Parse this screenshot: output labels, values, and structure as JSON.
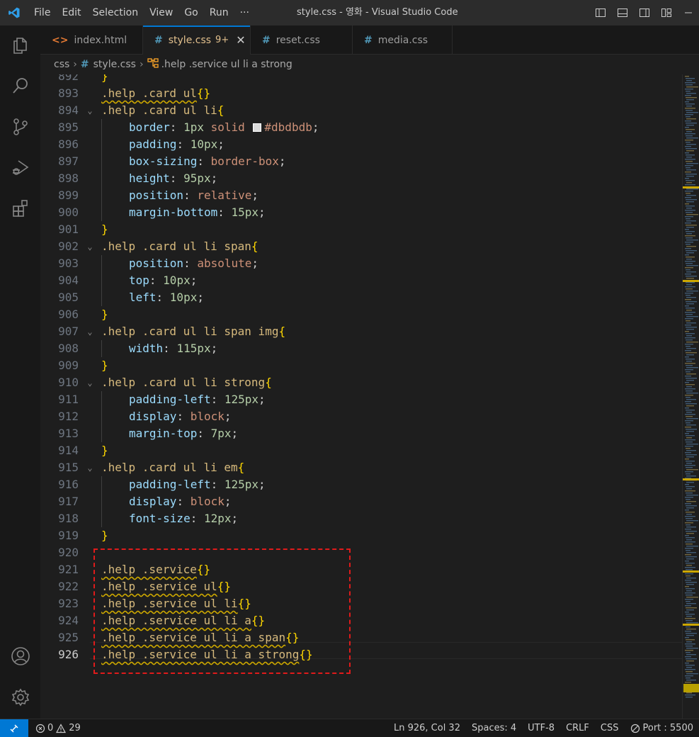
{
  "window": {
    "title": "style.css - 영화 - Visual Studio Code",
    "menu": [
      "File",
      "Edit",
      "Selection",
      "View",
      "Go",
      "Run",
      "···"
    ]
  },
  "tabs": [
    {
      "label": "index.html",
      "icon": "html-file-icon",
      "icon_glyph": "<>",
      "active": false
    },
    {
      "label": "style.css",
      "icon": "css-file-icon",
      "icon_glyph": "#",
      "active": true,
      "badge": "9+"
    },
    {
      "label": "reset.css",
      "icon": "css-file-icon",
      "icon_glyph": "#",
      "active": false
    },
    {
      "label": "media.css",
      "icon": "css-file-icon",
      "icon_glyph": "#",
      "active": false
    }
  ],
  "breadcrumb": {
    "folder": "css",
    "file": "style.css",
    "symbol": ".help .service ul li a strong"
  },
  "editor": {
    "current_line": 926,
    "lines": [
      {
        "n": "892",
        "tokens": [
          {
            "t": "}",
            "c": "brace"
          }
        ]
      },
      {
        "n": "893",
        "tokens": [
          {
            "t": ".help .card ul",
            "c": "sel squig"
          },
          {
            "t": "{}",
            "c": "brace"
          }
        ]
      },
      {
        "n": "894",
        "fold": true,
        "tokens": [
          {
            "t": ".help .card ul li",
            "c": "sel"
          },
          {
            "t": "{",
            "c": "brace"
          }
        ]
      },
      {
        "n": "895",
        "indent": 1,
        "tokens": [
          {
            "t": "border",
            "c": "prop"
          },
          {
            "t": ": ",
            "c": "punc"
          },
          {
            "t": "1px",
            "c": "num"
          },
          {
            "t": " solid ",
            "c": "val"
          },
          {
            "swatch": "#dbdbdb"
          },
          {
            "t": "#dbdbdb",
            "c": "val"
          },
          {
            "t": ";",
            "c": "punc"
          }
        ]
      },
      {
        "n": "896",
        "indent": 1,
        "tokens": [
          {
            "t": "padding",
            "c": "prop"
          },
          {
            "t": ": ",
            "c": "punc"
          },
          {
            "t": "10px",
            "c": "num"
          },
          {
            "t": ";",
            "c": "punc"
          }
        ]
      },
      {
        "n": "897",
        "indent": 1,
        "tokens": [
          {
            "t": "box-sizing",
            "c": "prop"
          },
          {
            "t": ": ",
            "c": "punc"
          },
          {
            "t": "border-box",
            "c": "val"
          },
          {
            "t": ";",
            "c": "punc"
          }
        ]
      },
      {
        "n": "898",
        "indent": 1,
        "tokens": [
          {
            "t": "height",
            "c": "prop"
          },
          {
            "t": ": ",
            "c": "punc"
          },
          {
            "t": "95px",
            "c": "num"
          },
          {
            "t": ";",
            "c": "punc"
          }
        ]
      },
      {
        "n": "899",
        "indent": 1,
        "tokens": [
          {
            "t": "position",
            "c": "prop"
          },
          {
            "t": ": ",
            "c": "punc"
          },
          {
            "t": "relative",
            "c": "val"
          },
          {
            "t": ";",
            "c": "punc"
          }
        ]
      },
      {
        "n": "900",
        "indent": 1,
        "tokens": [
          {
            "t": "margin-bottom",
            "c": "prop"
          },
          {
            "t": ": ",
            "c": "punc"
          },
          {
            "t": "15px",
            "c": "num"
          },
          {
            "t": ";",
            "c": "punc"
          }
        ]
      },
      {
        "n": "901",
        "tokens": [
          {
            "t": "}",
            "c": "brace"
          }
        ]
      },
      {
        "n": "902",
        "fold": true,
        "tokens": [
          {
            "t": ".help .card ul li span",
            "c": "sel"
          },
          {
            "t": "{",
            "c": "brace"
          }
        ]
      },
      {
        "n": "903",
        "indent": 1,
        "tokens": [
          {
            "t": "position",
            "c": "prop"
          },
          {
            "t": ": ",
            "c": "punc"
          },
          {
            "t": "absolute",
            "c": "val"
          },
          {
            "t": ";",
            "c": "punc"
          }
        ]
      },
      {
        "n": "904",
        "indent": 1,
        "tokens": [
          {
            "t": "top",
            "c": "prop"
          },
          {
            "t": ": ",
            "c": "punc"
          },
          {
            "t": "10px",
            "c": "num"
          },
          {
            "t": ";",
            "c": "punc"
          }
        ]
      },
      {
        "n": "905",
        "indent": 1,
        "tokens": [
          {
            "t": "left",
            "c": "prop"
          },
          {
            "t": ": ",
            "c": "punc"
          },
          {
            "t": "10px",
            "c": "num"
          },
          {
            "t": ";",
            "c": "punc"
          }
        ]
      },
      {
        "n": "906",
        "tokens": [
          {
            "t": "}",
            "c": "brace"
          }
        ]
      },
      {
        "n": "907",
        "fold": true,
        "tokens": [
          {
            "t": ".help .card ul li span img",
            "c": "sel"
          },
          {
            "t": "{",
            "c": "brace"
          }
        ]
      },
      {
        "n": "908",
        "indent": 1,
        "tokens": [
          {
            "t": "width",
            "c": "prop"
          },
          {
            "t": ": ",
            "c": "punc"
          },
          {
            "t": "115px",
            "c": "num"
          },
          {
            "t": ";",
            "c": "punc"
          }
        ]
      },
      {
        "n": "909",
        "tokens": [
          {
            "t": "}",
            "c": "brace"
          }
        ]
      },
      {
        "n": "910",
        "fold": true,
        "tokens": [
          {
            "t": ".help .card ul li strong",
            "c": "sel"
          },
          {
            "t": "{",
            "c": "brace"
          }
        ]
      },
      {
        "n": "911",
        "indent": 1,
        "tokens": [
          {
            "t": "padding-left",
            "c": "prop"
          },
          {
            "t": ": ",
            "c": "punc"
          },
          {
            "t": "125px",
            "c": "num"
          },
          {
            "t": ";",
            "c": "punc"
          }
        ]
      },
      {
        "n": "912",
        "indent": 1,
        "tokens": [
          {
            "t": "display",
            "c": "prop"
          },
          {
            "t": ": ",
            "c": "punc"
          },
          {
            "t": "block",
            "c": "val"
          },
          {
            "t": ";",
            "c": "punc"
          }
        ]
      },
      {
        "n": "913",
        "indent": 1,
        "tokens": [
          {
            "t": "margin-top",
            "c": "prop"
          },
          {
            "t": ": ",
            "c": "punc"
          },
          {
            "t": "7px",
            "c": "num"
          },
          {
            "t": ";",
            "c": "punc"
          }
        ]
      },
      {
        "n": "914",
        "tokens": [
          {
            "t": "}",
            "c": "brace"
          }
        ]
      },
      {
        "n": "915",
        "fold": true,
        "tokens": [
          {
            "t": ".help .card ul li em",
            "c": "sel"
          },
          {
            "t": "{",
            "c": "brace"
          }
        ]
      },
      {
        "n": "916",
        "indent": 1,
        "tokens": [
          {
            "t": "padding-left",
            "c": "prop"
          },
          {
            "t": ": ",
            "c": "punc"
          },
          {
            "t": "125px",
            "c": "num"
          },
          {
            "t": ";",
            "c": "punc"
          }
        ]
      },
      {
        "n": "917",
        "indent": 1,
        "tokens": [
          {
            "t": "display",
            "c": "prop"
          },
          {
            "t": ": ",
            "c": "punc"
          },
          {
            "t": "block",
            "c": "val"
          },
          {
            "t": ";",
            "c": "punc"
          }
        ]
      },
      {
        "n": "918",
        "indent": 1,
        "tokens": [
          {
            "t": "font-size",
            "c": "prop"
          },
          {
            "t": ": ",
            "c": "punc"
          },
          {
            "t": "12px",
            "c": "num"
          },
          {
            "t": ";",
            "c": "punc"
          }
        ]
      },
      {
        "n": "919",
        "tokens": [
          {
            "t": "}",
            "c": "brace"
          }
        ]
      },
      {
        "n": "920",
        "tokens": []
      },
      {
        "n": "921",
        "tokens": [
          {
            "t": ".help .service",
            "c": "sel squig"
          },
          {
            "t": "{}",
            "c": "brace"
          }
        ]
      },
      {
        "n": "922",
        "tokens": [
          {
            "t": ".help .service ul",
            "c": "sel squig"
          },
          {
            "t": "{}",
            "c": "brace"
          }
        ]
      },
      {
        "n": "923",
        "tokens": [
          {
            "t": ".help .service ul li",
            "c": "sel squig"
          },
          {
            "t": "{}",
            "c": "brace"
          }
        ]
      },
      {
        "n": "924",
        "tokens": [
          {
            "t": ".help .service ul li a",
            "c": "sel squig"
          },
          {
            "t": "{}",
            "c": "brace"
          }
        ]
      },
      {
        "n": "925",
        "tokens": [
          {
            "t": ".help .service ul li a span",
            "c": "sel squig"
          },
          {
            "t": "{}",
            "c": "brace"
          }
        ]
      },
      {
        "n": "926",
        "tokens": [
          {
            "t": ".help .service ul li a strong",
            "c": "sel squig"
          },
          {
            "t": "{}",
            "c": "brace"
          }
        ]
      }
    ]
  },
  "statusbar": {
    "errors": "0",
    "warnings": "29",
    "position": "Ln 926, Col 32",
    "spaces": "Spaces: 4",
    "encoding": "UTF-8",
    "eol": "CRLF",
    "language": "CSS",
    "port": "Port : 5500"
  },
  "colors": {
    "accent": "#0078d4",
    "highlight_box": "#e01b1b",
    "selector": "#d7ba7d",
    "property": "#9cdcfe",
    "value": "#ce9178",
    "number": "#b5cea8",
    "bracket": "#ffd700"
  },
  "icons": {
    "activity": [
      "explorer-icon",
      "search-icon",
      "source-control-icon",
      "run-debug-icon",
      "extensions-icon",
      "account-icon",
      "settings-gear-icon"
    ],
    "title": "vscode-logo-icon",
    "layout": [
      "toggle-primary-sidebar-icon",
      "toggle-panel-icon",
      "toggle-secondary-sidebar-icon",
      "customize-layout-icon"
    ]
  }
}
